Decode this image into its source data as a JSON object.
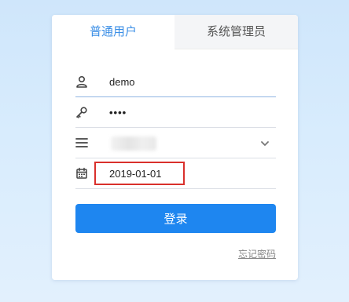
{
  "tabs": [
    {
      "label": "普通用户",
      "active": true
    },
    {
      "label": "系统管理员",
      "active": false
    }
  ],
  "form": {
    "username": "demo",
    "password_masked": "••••",
    "select_value": "",
    "date_value": "2019-01-01"
  },
  "buttons": {
    "login_label": "登录",
    "forgot_label": "忘记密码"
  },
  "icons": {
    "username": "user-icon",
    "password": "key-icon",
    "select": "list-icon",
    "date": "calendar-icon",
    "dropdown": "chevron-down-icon"
  },
  "colors": {
    "accent": "#1e86f0",
    "active_tab_text": "#3a8ee6",
    "highlight_box": "#d9302c"
  }
}
